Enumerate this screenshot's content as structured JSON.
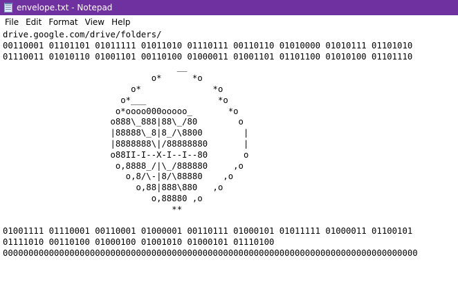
{
  "window": {
    "title": "envelope.txt - Notepad",
    "accent_color": "#7031a0",
    "icon": "notepad-icon"
  },
  "menu": {
    "items": [
      "File",
      "Edit",
      "Format",
      "View",
      "Help"
    ]
  },
  "editor": {
    "lines": [
      "drive.google.com/drive/folders/",
      "00110001 01101101 01011111 01011010 01110111 00110110 01010000 01010111 01101010",
      "01110011 01010110 01001101 00110100 01000011 01001101 01101100 01010100 01101110",
      "                                  __",
      "                             o*      *o",
      "                         o*              *o",
      "                       o*___              *o",
      "                      o*oooo000ooooo_       *o",
      "                     o888\\_888|88\\_/80        o",
      "                     |88888\\_8|8_/\\8800        |",
      "                     |8888888\\|/88888880       |",
      "                     o88II-I--X-I--I--80       o",
      "                      o,8888_/|\\_/888880     ,o",
      "                        o,8/\\-|8/\\88880    ,o",
      "                          o,88|888\\880   ,o",
      "                             o,88880 ,o",
      "                                 **",
      "",
      "01001111 01110001 00110001 01000001 00110111 01000101 01011111 01000011 01100101",
      "01111010 00110100 01000100 01001010 01000101 01110100",
      "000000000000000000000000000000000000000000000000000000000000000000000000000000000"
    ]
  }
}
